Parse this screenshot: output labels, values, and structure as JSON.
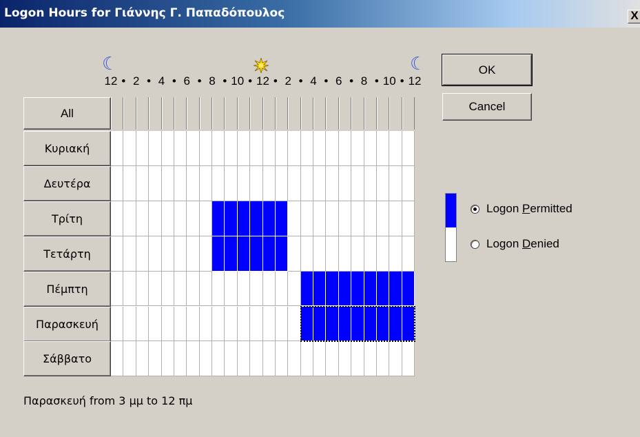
{
  "window": {
    "title": "Logon Hours for Γιάννης Γ. Παπαδόπουλος",
    "close_label": "X"
  },
  "scale": {
    "labels": [
      "12",
      "•",
      "2",
      "•",
      "4",
      "•",
      "6",
      "•",
      "8",
      "•",
      "10",
      "•",
      "12",
      "•",
      "2",
      "•",
      "4",
      "•",
      "6",
      "•",
      "8",
      "•",
      "10",
      "•",
      "12"
    ],
    "icons": [
      "moon-icon",
      "sun-icon",
      "moon-icon"
    ]
  },
  "grid": {
    "all_label": "All",
    "days": [
      {
        "label": "Κυριακή",
        "permitted_hours": []
      },
      {
        "label": "Δευτέρα",
        "permitted_hours": []
      },
      {
        "label": "Τρίτη",
        "permitted_hours": [
          8,
          9,
          10,
          11,
          12,
          13
        ]
      },
      {
        "label": "Τετάρτη",
        "permitted_hours": [
          8,
          9,
          10,
          11,
          12,
          13
        ]
      },
      {
        "label": "Πέμπτη",
        "permitted_hours": [
          15,
          16,
          17,
          18,
          19,
          20,
          21,
          22,
          23
        ]
      },
      {
        "label": "Παρασκευή",
        "permitted_hours": [
          15,
          16,
          17,
          18,
          19,
          20,
          21,
          22,
          23
        ]
      },
      {
        "label": "Σάββατο",
        "permitted_hours": []
      }
    ],
    "selected": {
      "day": "Παρασκευή",
      "from_hour": 15,
      "to_hour": 23
    },
    "colors": {
      "permitted": "#0000ff",
      "denied": "#ffffff"
    }
  },
  "buttons": {
    "ok_label": "OK",
    "cancel_label": "Cancel"
  },
  "legend": {
    "permitted": {
      "prefix": "Logon ",
      "accel": "P",
      "rest": "ermitted",
      "checked": true
    },
    "denied": {
      "prefix": "Logon ",
      "accel": "D",
      "rest": "enied",
      "checked": false
    }
  },
  "status_text": "Παρασκευή from 3 μμ to 12 πμ"
}
